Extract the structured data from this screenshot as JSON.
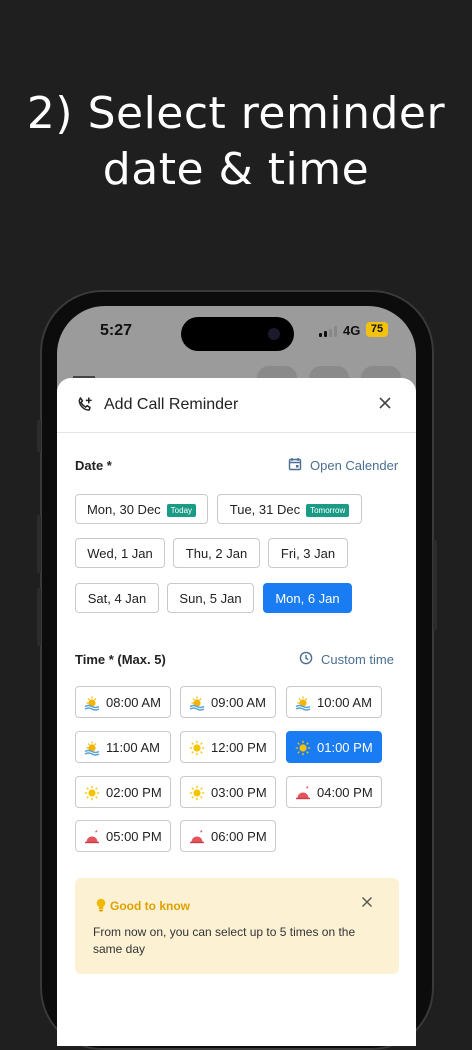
{
  "headline": {
    "line1": "2) Select reminder",
    "line2": "date & time"
  },
  "status_bar": {
    "time": "5:27",
    "network": "4G",
    "battery": "75"
  },
  "sheet": {
    "title": "Add Call Reminder",
    "date_label": "Date *",
    "open_calendar": "Open Calender",
    "dates": [
      {
        "label": "Mon, 30 Dec",
        "tag": "Today"
      },
      {
        "label": "Tue, 31 Dec",
        "tag": "Tomorrow"
      },
      {
        "label": "Wed, 1 Jan"
      },
      {
        "label": "Thu, 2 Jan"
      },
      {
        "label": "Fri, 3 Jan"
      },
      {
        "label": "Sat, 4 Jan"
      },
      {
        "label": "Sun, 5 Jan"
      },
      {
        "label": "Mon, 6 Jan",
        "selected": true
      }
    ],
    "time_label": "Time * (Max. 5)",
    "custom_time": "Custom time",
    "times": [
      {
        "label": "08:00 AM",
        "icon": "sunrise-icon"
      },
      {
        "label": "09:00 AM",
        "icon": "sunrise-icon"
      },
      {
        "label": "10:00 AM",
        "icon": "sunrise-icon"
      },
      {
        "label": "11:00 AM",
        "icon": "sunrise-icon"
      },
      {
        "label": "12:00 PM",
        "icon": "sun-icon"
      },
      {
        "label": "01:00 PM",
        "icon": "sun-icon",
        "selected": true
      },
      {
        "label": "02:00 PM",
        "icon": "sun-icon"
      },
      {
        "label": "03:00 PM",
        "icon": "sun-icon"
      },
      {
        "label": "04:00 PM",
        "icon": "sunset-icon"
      },
      {
        "label": "05:00 PM",
        "icon": "sunset-icon"
      },
      {
        "label": "06:00 PM",
        "icon": "sunset-icon"
      }
    ],
    "tip": {
      "title": "Good to know",
      "body": "From now on, you can select up to 5 times on the same day"
    }
  },
  "colors": {
    "accent": "#1a7cf2",
    "tag": "#1a9b86",
    "tip_bg": "#fdf1d4",
    "tip_title": "#e0a100"
  }
}
